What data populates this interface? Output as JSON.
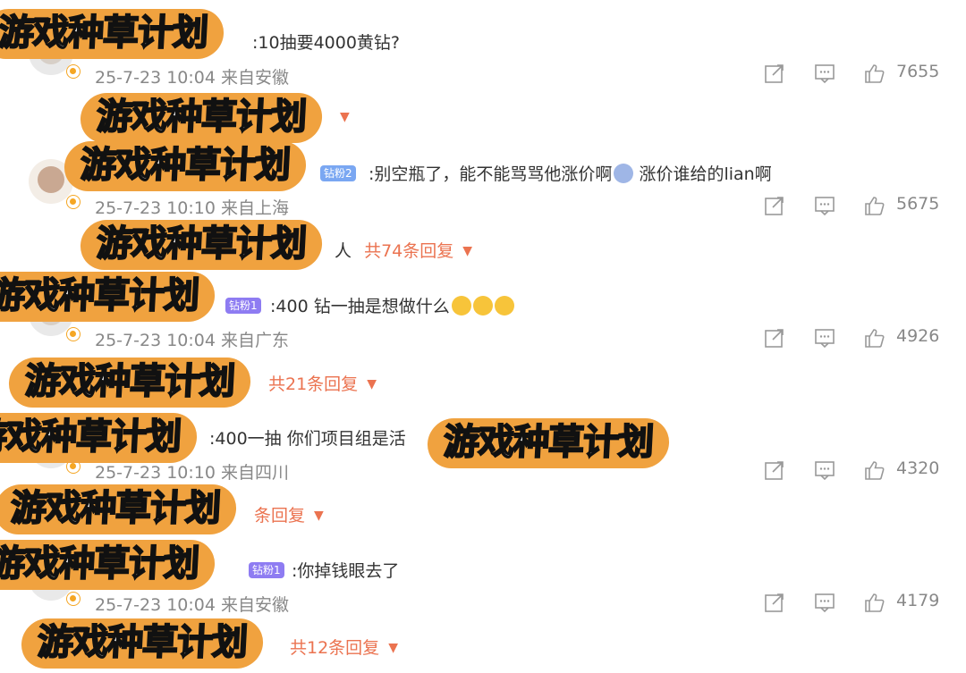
{
  "watermark_text": "游戏种草计划",
  "fan_badges": {
    "c2": "钻粉2",
    "c3": "钻粉1",
    "c5": "钻粉1"
  },
  "comments": [
    {
      "text": ":10抽要4000黄钻?",
      "meta": "25-7-23 10:04 来自安徽",
      "likes": "7655"
    },
    {
      "text": ":别空瓶了，能不能骂骂他涨价啊",
      "text_tail": "涨价谁给的lian啊",
      "meta": "25-7-23 10:10 来自上海",
      "likes": "5675",
      "replies_suffix": "人",
      "replies": "共74条回复"
    },
    {
      "text": ":400 钻一抽是想做什么",
      "meta": "25-7-23 10:04 来自广东",
      "likes": "4926",
      "replies": "共21条回复"
    },
    {
      "text": ":400一抽 你们项目组是活",
      "meta": "25-7-23 10:10 来自四川",
      "likes": "4320",
      "replies": "条回复"
    },
    {
      "text": ":你掉钱眼去了",
      "meta": "25-7-23 10:04 来自安徽",
      "likes": "4179",
      "replies": "共12条回复"
    }
  ],
  "colors": {
    "accent": "#eb7350",
    "watermark_bg": "#f0a23f",
    "badge": "#f5a623",
    "fan_badge": "#8e7cf2"
  },
  "icons": {
    "share": "share-icon",
    "comment": "comment-icon",
    "like": "thumbs-up-icon",
    "expand": "caret-down-icon"
  }
}
